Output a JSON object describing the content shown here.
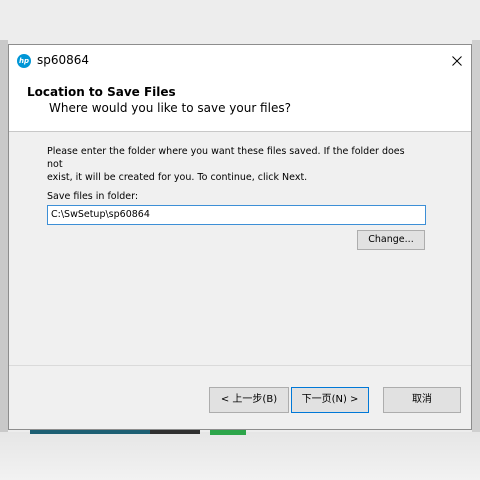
{
  "window": {
    "title": "sp60864",
    "logo_text": "hp"
  },
  "header": {
    "title": "Location to Save Files",
    "subtitle": "Where would you like to save your files?"
  },
  "body": {
    "instructions_line1": "Please enter the folder where you want these files saved.  If the folder does not",
    "instructions_line2": "exist, it will be created for you.  To continue, click Next.",
    "folder_label": "Save files in folder:",
    "folder_value": "C:\\SwSetup\\sp60864",
    "change_label": "Change..."
  },
  "footer": {
    "back_label": "< 上一步(B)",
    "next_label": "下一页(N) >",
    "cancel_label": "取消"
  },
  "colors": {
    "hp_blue": "#0096d6",
    "focus_border": "#3d8fd6"
  }
}
